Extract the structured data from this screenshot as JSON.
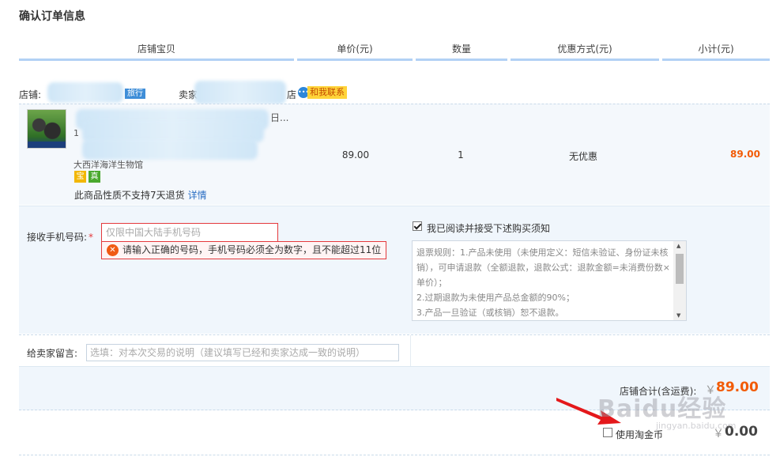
{
  "page": {
    "title": "确认订单信息"
  },
  "table_header": {
    "columns": [
      "店铺宝贝",
      "单价(元)",
      "数量",
      "优惠方式(元)",
      "小计(元)"
    ]
  },
  "shop": {
    "label": "店铺:",
    "travel_tag": "旅行",
    "seller_label": "卖家",
    "seller_tail": "店",
    "contact_icon": "chat-bubble-icon",
    "contact_label": "和我联系"
  },
  "item": {
    "name_tail": "日...",
    "number_fragment": "1",
    "desc_fragment": "大西洋海洋生物馆",
    "badges": [
      "宝",
      "真"
    ],
    "no_return_text": "此商品性质不支持7天退货",
    "details_link": "详情",
    "unit_price": "89.00",
    "quantity": "1",
    "discount": "无优惠",
    "subtotal": "89.00"
  },
  "phone": {
    "label": "接收手机号码:",
    "required_mark": "*",
    "placeholder": "仅限中国大陆手机号码",
    "error_message": "请输入正确的号码，手机号码必须全为数字，且不能超过11位"
  },
  "agreement": {
    "checked": true,
    "label": "我已阅读并接受下述购买须知",
    "rules_text": "退票规则：1.产品未使用（未使用定义：短信未验证、身份证未核销），可申请退款（全额退款，退款公式：退款金额=未消费份数×单价）；\n2.过期退款为未使用产品总金额的90%；\n3.产品一旦验证（或核销）恕不退款。\n改期规则：不得改期。"
  },
  "message": {
    "label": "给卖家留言:",
    "placeholder": "选填：对本次交易的说明（建议填写已经和卖家达成一致的说明）"
  },
  "shop_total": {
    "label": "店铺合计(含运费):",
    "currency": "￥",
    "value": "89.00"
  },
  "taojinbi": {
    "checked": false,
    "label": "使用淘金币",
    "currency": "￥",
    "value": "0.00"
  },
  "watermark": {
    "text": "Baidu经验",
    "sub": "jingyan.baidu.com"
  },
  "colors": {
    "price_orange": "#f25b05",
    "error_red": "#e4393c",
    "header_border": "#b2d1f5",
    "row_bg": "#f0f6fc"
  }
}
